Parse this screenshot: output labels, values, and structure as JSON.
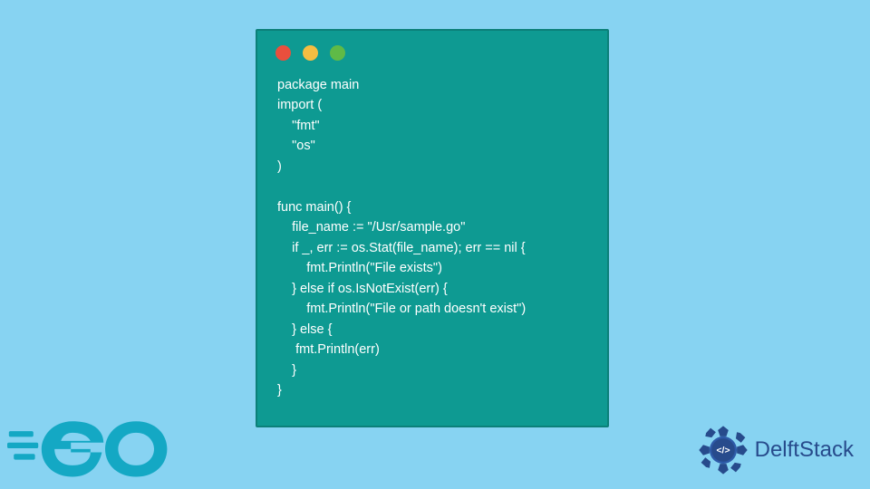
{
  "traffic_lights": [
    "red",
    "yellow",
    "green"
  ],
  "code": "package main\nimport (\n    \"fmt\"\n    \"os\"\n)\n\nfunc main() {\n    file_name := \"/Usr/sample.go\"\n    if _, err := os.Stat(file_name); err == nil {\n        fmt.Println(\"File exists\")\n    } else if os.IsNotExist(err) {\n        fmt.Println(\"File or path doesn't exist\")\n    } else {\n     fmt.Println(err)\n    }\n}",
  "go_logo_text": "GO",
  "delftstack_text": "DelftStack"
}
